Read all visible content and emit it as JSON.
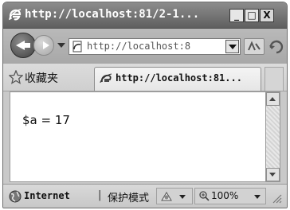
{
  "window": {
    "title": "http://localhost:81/2-1...",
    "minimize_label": "_",
    "maximize_label": "□",
    "close_label": "X"
  },
  "navigation": {
    "address": "http://localhost:8",
    "address_host": "localhost"
  },
  "favorites": {
    "label": "收藏夹",
    "tab_title": "http://localhost:81..."
  },
  "content": {
    "text": "$a = 17"
  },
  "status": {
    "zone": "Internet",
    "separator": "|",
    "protected_mode": "保护模式",
    "zoom": "100%"
  },
  "icons": {
    "title": "ie-logo-icon",
    "back": "back-arrow-icon",
    "forward": "forward-arrow-icon",
    "page": "page-icon",
    "compat": "compatibility-view-icon",
    "refresh": "refresh-icon",
    "favorites": "favorites-star-icon",
    "globe": "globe-icon",
    "security": "security-icon",
    "zoom": "magnifier-icon"
  },
  "colors": {
    "titlebar": "#6f6f6f",
    "chrome": "#c9c9c9",
    "content_bg": "#ffffff"
  }
}
